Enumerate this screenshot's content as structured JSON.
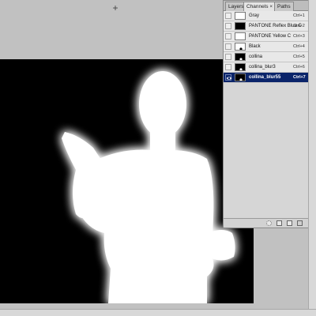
{
  "tabs": [
    {
      "label": "Layers",
      "active": false
    },
    {
      "label": "Channels",
      "active": true
    },
    {
      "label": "Paths",
      "active": false
    }
  ],
  "tab_close": "×",
  "channels": [
    {
      "name": "Gray",
      "shortcut": "Ctrl+1",
      "thumb": "white",
      "visible": false,
      "selected": false
    },
    {
      "name": "PANTONE Reflex Blue C",
      "shortcut": "Ctrl+2",
      "thumb": "black",
      "visible": false,
      "selected": false
    },
    {
      "name": "PANTONE Yellow C",
      "shortcut": "Ctrl+3",
      "thumb": "white",
      "visible": false,
      "selected": false
    },
    {
      "name": "Black",
      "shortcut": "Ctrl+4",
      "thumb": "figure-on-white",
      "visible": false,
      "selected": false
    },
    {
      "name": "collina",
      "shortcut": "Ctrl+5",
      "thumb": "figure-on-black",
      "visible": false,
      "selected": false
    },
    {
      "name": "collina_blur3",
      "shortcut": "Ctrl+6",
      "thumb": "figure-on-black",
      "visible": false,
      "selected": false
    },
    {
      "name": "collina_blur55",
      "shortcut": "Ctrl+7",
      "thumb": "figure-on-black",
      "visible": true,
      "selected": true
    }
  ],
  "colors": {
    "selection": "#0a246a",
    "canvas": "#000000",
    "figure": "#ffffff",
    "workspace": "#c1c1c1"
  },
  "icons": {
    "crosshair": "crosshair-cursor-icon",
    "eye": "eye-icon",
    "load_selection": "dotted-circle-icon",
    "save_selection": "mask-icon",
    "new_channel": "new-page-icon",
    "delete_channel": "trash-icon"
  }
}
